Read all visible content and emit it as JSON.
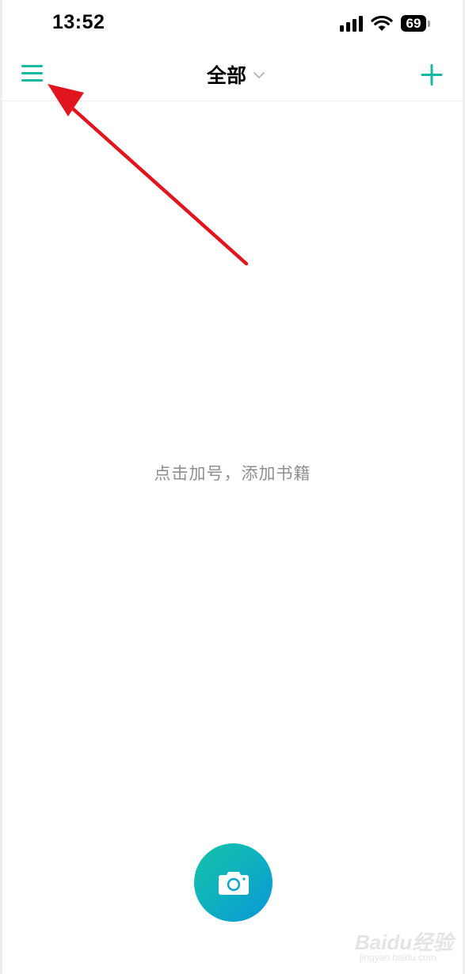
{
  "status_bar": {
    "time": "13:52",
    "battery": "69",
    "icons": [
      "signal-icon",
      "wifi-icon",
      "battery-icon"
    ]
  },
  "nav": {
    "title": "全部",
    "menu_icon": "hamburger-menu-icon",
    "dropdown_icon": "chevron-down-icon",
    "add_icon": "plus-icon"
  },
  "empty_state": {
    "message": "点击加号，添加书籍"
  },
  "camera": {
    "icon": "camera-icon"
  },
  "watermark": {
    "main": "Baidu经验",
    "sub": "jingyan.baidu.com"
  },
  "colors": {
    "accent": "#17b99d",
    "annotation_arrow": "#e0151e",
    "hint_text": "#8e8e8e",
    "camera_gradient_start": "#14c3a6",
    "camera_gradient_end": "#0b96d8"
  }
}
